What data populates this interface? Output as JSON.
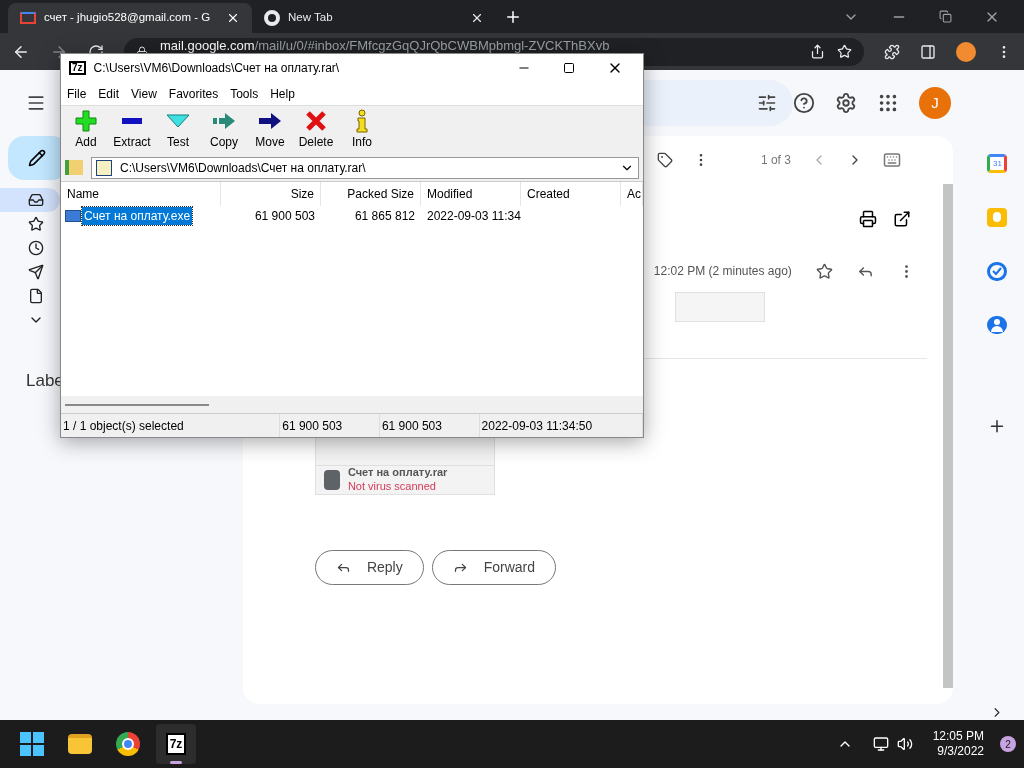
{
  "browser": {
    "tabs": [
      {
        "title": "счет - jhugio528@gmail.com - G",
        "kind": "gmail",
        "selected": true
      },
      {
        "title": "New Tab",
        "kind": "chrome",
        "selected": false
      }
    ],
    "url_host": "mail.google.com",
    "url_path": "/mail/u/0/#inbox/FMfcgzGqQJrQbCWBMpbmgl-ZVCKThBXvb"
  },
  "gmail": {
    "nav": [
      {
        "kind": "inbox",
        "selected": true
      },
      {
        "kind": "starred",
        "selected": false
      },
      {
        "kind": "snoozed",
        "selected": false
      },
      {
        "kind": "sent",
        "selected": false
      },
      {
        "kind": "drafts",
        "selected": false
      },
      {
        "kind": "more",
        "selected": false
      }
    ],
    "labels_heading": "Labe",
    "avatar": "J",
    "pager": "1 of 3",
    "timestamp": "12:02 PM (2 minutes ago)",
    "attachment": {
      "name": "Счет на оплату.rar",
      "status": "Not virus scanned"
    },
    "actions": [
      {
        "label": "Reply",
        "kind": "reply"
      },
      {
        "label": "Forward",
        "kind": "forward"
      }
    ],
    "side_apps": [
      {
        "kind": "calendar",
        "label": "31"
      },
      {
        "kind": "keep"
      },
      {
        "kind": "tasks"
      },
      {
        "kind": "contacts"
      }
    ]
  },
  "archiver": {
    "app_icon": "7z",
    "title": "C:\\Users\\VM6\\Downloads\\Счет на оплату.rar\\",
    "menu": [
      "File",
      "Edit",
      "View",
      "Favorites",
      "Tools",
      "Help"
    ],
    "toolbar": [
      {
        "label": "Add",
        "kind": "add"
      },
      {
        "label": "Extract",
        "kind": "extract"
      },
      {
        "label": "Test",
        "kind": "test"
      },
      {
        "label": "Copy",
        "kind": "copy"
      },
      {
        "label": "Move",
        "kind": "move"
      },
      {
        "label": "Delete",
        "kind": "delete"
      },
      {
        "label": "Info",
        "kind": "info"
      }
    ],
    "address": "C:\\Users\\VM6\\Downloads\\Счет на оплату.rar\\",
    "columns": [
      "Name",
      "Size",
      "Packed Size",
      "Modified",
      "Created",
      "Ac"
    ],
    "rows": [
      {
        "cells": [
          "Счет на оплату.exe",
          "61 900 503",
          "61 865 812",
          "2022-09-03 11:34"
        ],
        "selected": true
      }
    ],
    "status": [
      "1 / 1 object(s) selected",
      "61 900 503",
      "61 900 503",
      "2022-09-03 11:34:50"
    ]
  },
  "taskbar": {
    "apps": [
      {
        "kind": "start",
        "active": false
      },
      {
        "kind": "explorer",
        "active": false
      },
      {
        "kind": "chrome",
        "active": false
      },
      {
        "kind": "archiver",
        "label": "7z",
        "active": true
      }
    ],
    "time": "12:05 PM",
    "date": "9/3/2022",
    "notifications": "2"
  }
}
